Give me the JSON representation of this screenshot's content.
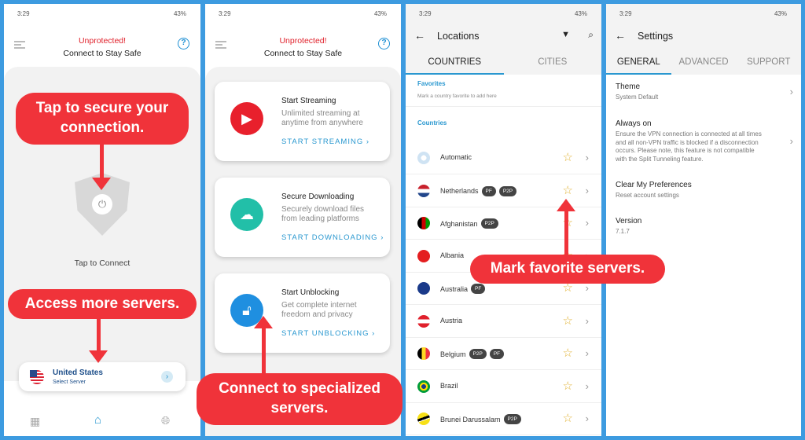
{
  "status": {
    "time": "3:29",
    "battery": "43%"
  },
  "home": {
    "title": "Unprotected!",
    "subtitle": "Connect to Stay Safe",
    "tap_label": "Tap to Connect",
    "server": {
      "country": "United States",
      "sub": "Select Server"
    }
  },
  "features": {
    "title": "Unprotected!",
    "subtitle": "Connect to Stay Safe",
    "cards": [
      {
        "title": "Start Streaming",
        "desc": "Unlimited streaming at anytime from anywhere",
        "link": "START STREAMING  ›",
        "color": "#e8202c",
        "icon": "monitor-play-icon"
      },
      {
        "title": "Secure Downloading",
        "desc": "Securely download files from leading platforms",
        "link": "START DOWNLOADING  ›",
        "color": "#22bfa8",
        "icon": "cloud-download-icon"
      },
      {
        "title": "Start Unblocking",
        "desc": "Get complete internet freedom and privacy",
        "link": "START UNBLOCKING  ›",
        "color": "#1f8fe0",
        "icon": "unlock-icon"
      }
    ]
  },
  "locations": {
    "title": "Locations",
    "tabs": [
      "COUNTRIES",
      "CITIES"
    ],
    "favorites_label": "Favorites",
    "favorites_hint": "Mark a country favorite to add here",
    "countries_label": "Countries",
    "rows": [
      {
        "name": "Automatic",
        "badges": []
      },
      {
        "name": "Netherlands",
        "badges": [
          "PF",
          "P2P"
        ]
      },
      {
        "name": "Afghanistan",
        "badges": [
          "P2P"
        ]
      },
      {
        "name": "Albania",
        "badges": []
      },
      {
        "name": "Australia",
        "badges": [
          "PF"
        ]
      },
      {
        "name": "Austria",
        "badges": []
      },
      {
        "name": "Belgium",
        "badges": [
          "P2P",
          "PF"
        ]
      },
      {
        "name": "Brazil",
        "badges": []
      },
      {
        "name": "Brunei Darussalam",
        "badges": [
          "P2P"
        ]
      }
    ]
  },
  "settings": {
    "title": "Settings",
    "tabs": [
      "GENERAL",
      "ADVANCED",
      "SUPPORT"
    ],
    "items": [
      {
        "h": "Theme",
        "d": "System Default"
      },
      {
        "h": "Always on",
        "d": "Ensure the VPN connection is connected at all times and all non-VPN traffic is blocked if a disconnection occurs. Please note, this feature is not compatible with the Split Tunneling feature."
      },
      {
        "h": "Clear My Preferences",
        "d": "Reset account settings"
      },
      {
        "h": "Version",
        "d": "7.1.7"
      }
    ]
  },
  "callouts": {
    "secure": "Tap to secure your connection.",
    "servers": "Access more servers.",
    "specialized": "Connect to specialized servers.",
    "favorite": "Mark favorite servers."
  }
}
